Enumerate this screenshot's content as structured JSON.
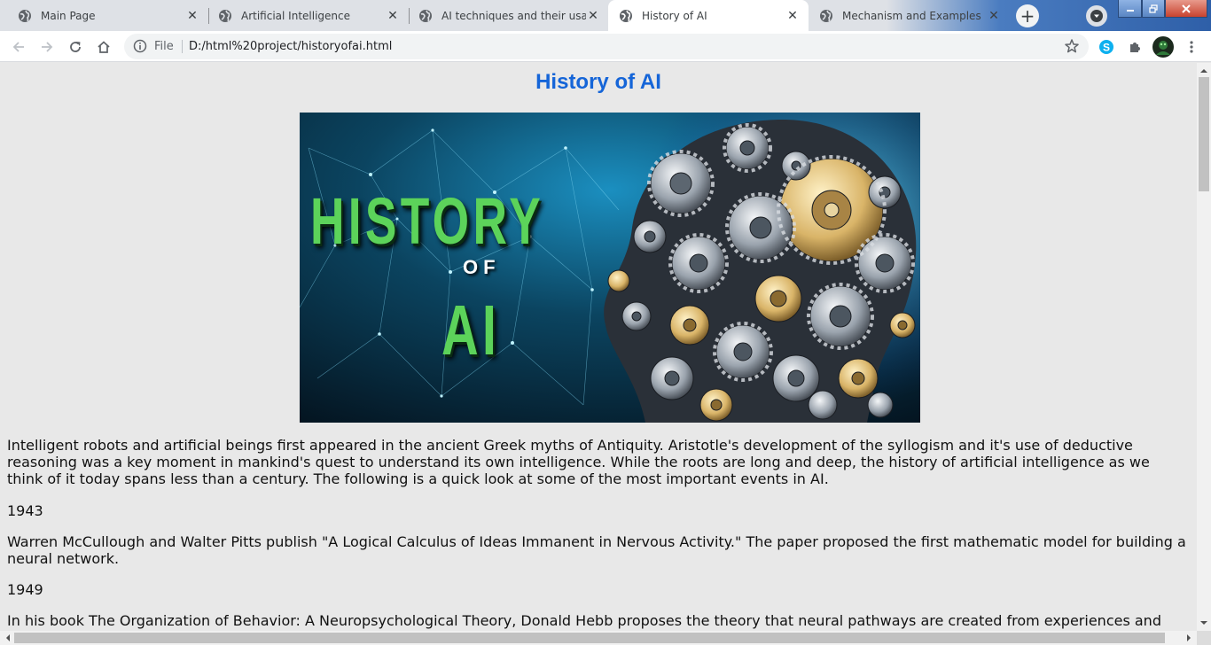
{
  "browser": {
    "tabs": [
      {
        "title": "Main Page",
        "active": false
      },
      {
        "title": "Artificial Intelligence",
        "active": false
      },
      {
        "title": "AI techniques and their usage",
        "active": false
      },
      {
        "title": "History of AI",
        "active": true
      },
      {
        "title": "Mechanism and Examples",
        "active": false
      }
    ],
    "close_glyph": "✕",
    "new_tab_glyph": "+",
    "address": {
      "scheme_label": "File",
      "url": "D:/html%20project/historyofai.html"
    },
    "icons": [
      "back-arrow-icon",
      "forward-arrow-icon",
      "reload-icon",
      "home-icon",
      "info-icon",
      "star-icon",
      "skype-icon",
      "extensions-puzzle-icon",
      "profile-avatar",
      "kebab-menu-icon"
    ],
    "colors": {
      "tabstrip": "#dee1e6",
      "active_tab": "#ffffff",
      "heading": "#1565d8",
      "page_bg": "#e8e8e8"
    }
  },
  "page": {
    "title": "History of AI",
    "hero": {
      "word_history": "HISTORY",
      "word_of": "OF",
      "word_ai": "AI"
    },
    "intro": "Intelligent robots and artificial beings first appeared in the ancient Greek myths of Antiquity. Aristotle's development of the syllogism and it's use of deductive reasoning was a key moment in mankind's quest to understand its own intelligence. While the roots are long and deep, the history of artificial intelligence as we think of it today spans less than a century. The following is a quick look at some of the most important events in AI.",
    "events": [
      {
        "year": "1943",
        "text": "Warren McCullough and Walter Pitts publish \"A Logical Calculus of Ideas Immanent in Nervous Activity.\" The paper proposed the first mathematic model for building a neural network."
      },
      {
        "year": "1949",
        "text": "In his book The Organization of Behavior: A Neuropsychological Theory, Donald Hebb proposes the theory that neural pathways are created from experiences and"
      }
    ]
  }
}
